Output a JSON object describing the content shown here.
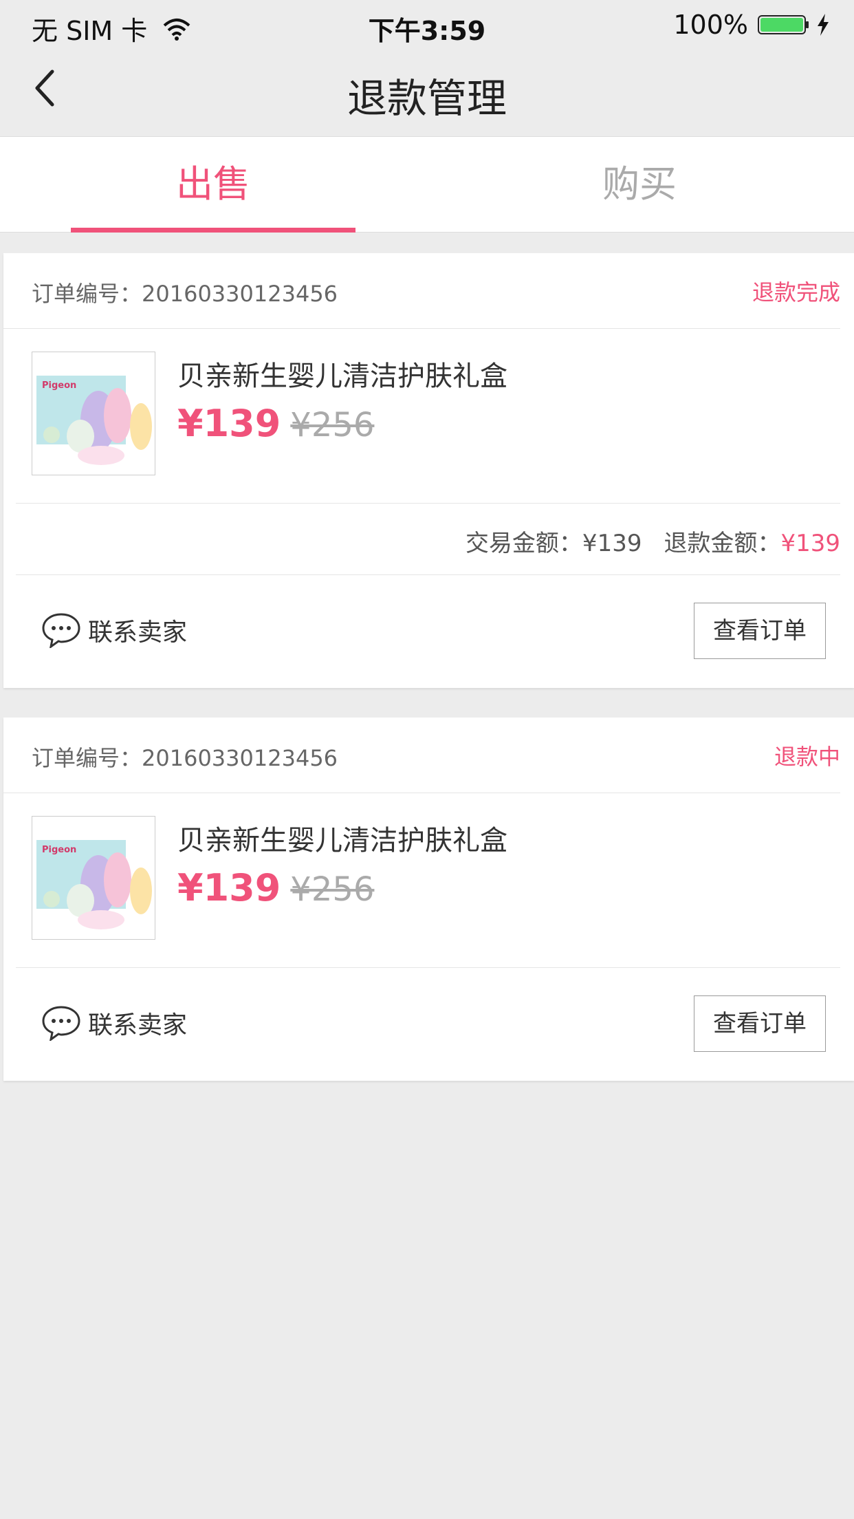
{
  "status_bar": {
    "carrier": "无 SIM 卡",
    "time": "下午3:59",
    "battery": "100%"
  },
  "nav": {
    "title": "退款管理",
    "back_icon": "chevron-left-icon"
  },
  "tabs": [
    {
      "label": "出售",
      "active": true
    },
    {
      "label": "购买",
      "active": false
    }
  ],
  "colors": {
    "accent": "#f0527a",
    "background": "#ececec"
  },
  "orders": [
    {
      "order_label": "订单编号：20160330123456",
      "status": "退款完成",
      "product_name": "贝亲新生婴儿清洁护肤礼盒",
      "price": "¥139",
      "original_price": "¥256",
      "trade_amount": "交易金额：¥139",
      "refund_label": "退款金额：",
      "refund_value": "¥139",
      "contact": "联系卖家",
      "view_order": "查看订单"
    },
    {
      "order_label": "订单编号：20160330123456",
      "status": "退款中",
      "product_name": "贝亲新生婴儿清洁护肤礼盒",
      "price": "¥139",
      "original_price": "¥256",
      "contact": "联系卖家",
      "view_order": "查看订单"
    }
  ],
  "product_image": {
    "brand": "Pigeon"
  }
}
